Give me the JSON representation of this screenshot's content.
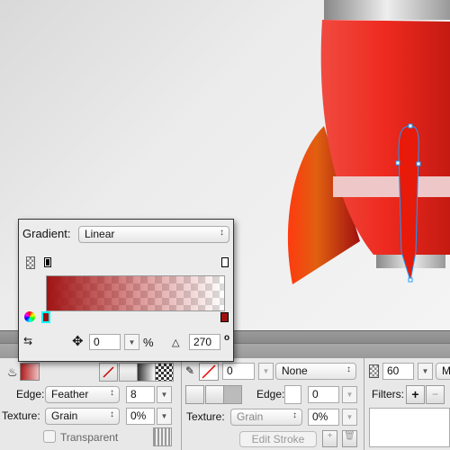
{
  "colors": {
    "accent": "#b01c1c",
    "selection": "#1a9cff",
    "rocket_red": "#e8261c"
  },
  "gradient_popup": {
    "label": "Gradient:",
    "type": "Linear",
    "position_value": "0",
    "position_unit": "%",
    "angle_value": "270",
    "angle_unit": "o",
    "icons": [
      "checker-icon",
      "color-wheel-icon",
      "swap-icon",
      "move-icon",
      "angle-icon"
    ]
  },
  "fill": {
    "edge_label": "Edge:",
    "edge_type": "Feather",
    "edge_value": "8",
    "texture_label": "Texture:",
    "texture": "Grain",
    "texture_amount": "0%",
    "transparent_label": "Transparent"
  },
  "stroke": {
    "size": "0",
    "style": "None",
    "edge_label": "Edge:",
    "edge_value": "0",
    "texture_label": "Texture:",
    "texture": "Grain",
    "texture_amount": "0%",
    "edit_stroke_label": "Edit Stroke"
  },
  "effects": {
    "opacity": "60",
    "blend_partial": "M",
    "filters_label": "Filters:"
  }
}
